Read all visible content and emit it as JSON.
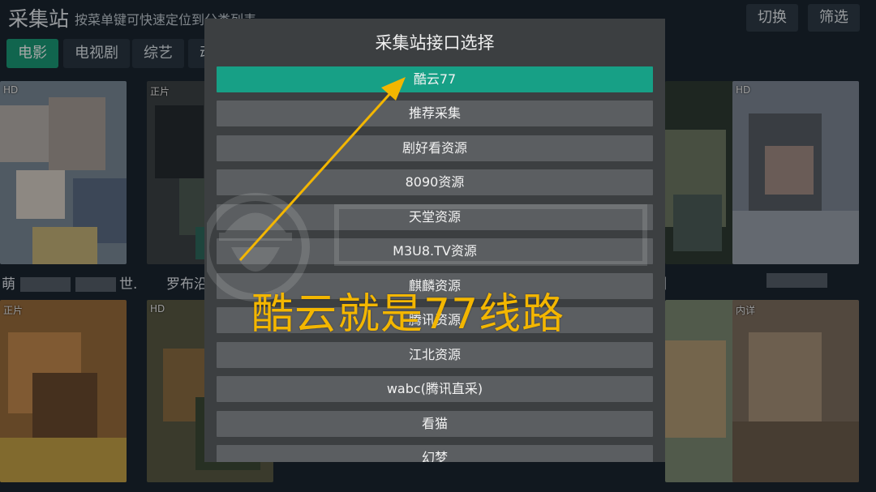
{
  "header": {
    "title": "采集站",
    "hint": "按菜单键可快速定位到分类列表",
    "switch_label": "切换",
    "filter_label": "筛选"
  },
  "tabs": [
    {
      "label": "电影",
      "active": true
    },
    {
      "label": "电视剧",
      "active": false
    },
    {
      "label": "综艺",
      "active": false
    },
    {
      "label": "动",
      "active": false
    }
  ],
  "grid": {
    "row1": [
      {
        "badge": "HD",
        "caption_left": "萌",
        "caption_right": "世."
      },
      {
        "badge": "正片",
        "caption_left": "罗布沿"
      },
      {
        "badge": "",
        "caption_left": ""
      },
      {
        "badge": "",
        "caption_left": ""
      },
      {
        "badge": "",
        "caption_left": ""
      },
      {
        "badge": "",
        "caption_left": "】"
      },
      {
        "badge": "HD",
        "caption_left": ""
      }
    ],
    "row2": [
      {
        "badge": "正片"
      },
      {
        "badge": "HD"
      },
      {
        "badge": ""
      },
      {
        "badge": ""
      },
      {
        "badge": ""
      },
      {
        "badge": ""
      },
      {
        "badge": "内详"
      }
    ]
  },
  "dialog": {
    "title": "采集站接口选择",
    "options": [
      "酷云77",
      "推荐采集",
      "剧好看资源",
      "8090资源",
      "天堂资源",
      "M3U8.TV资源",
      "麒麟资源",
      "腾讯资源",
      "江北资源",
      "wabc(腾讯直采)",
      "看猫",
      "幻梦"
    ],
    "selected_index": 0
  },
  "annotation": {
    "text": "酷云就是77线路"
  },
  "colors": {
    "accent": "#17a086",
    "annotation": "#f3b600",
    "tab_active": "#1b9c78"
  }
}
